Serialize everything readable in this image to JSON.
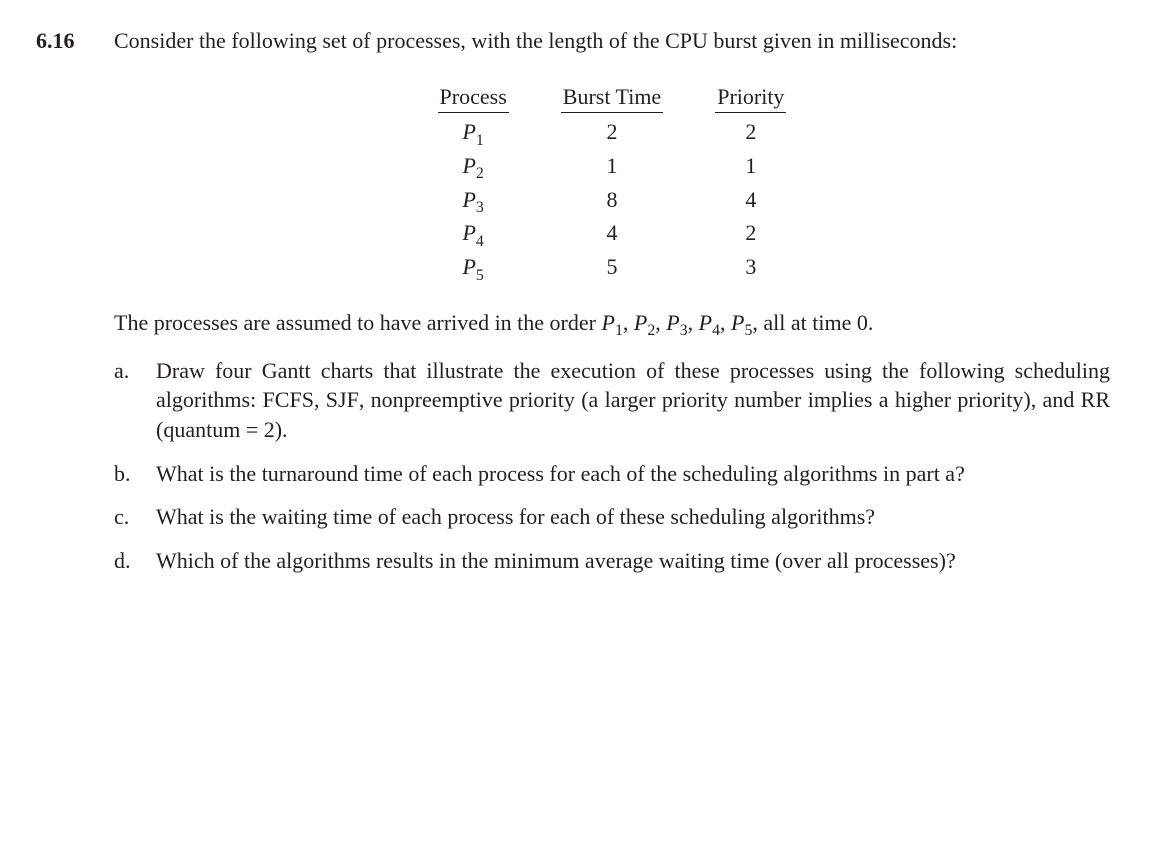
{
  "problem_number": "6.16",
  "intro": "Consider the following set of processes, with the length of the CPU burst given in milliseconds:",
  "table": {
    "headers": [
      "Process",
      "Burst Time",
      "Priority"
    ],
    "rows": [
      {
        "process": "P",
        "sub": "1",
        "burst": "2",
        "priority": "2"
      },
      {
        "process": "P",
        "sub": "2",
        "burst": "1",
        "priority": "1"
      },
      {
        "process": "P",
        "sub": "3",
        "burst": "8",
        "priority": "4"
      },
      {
        "process": "P",
        "sub": "4",
        "burst": "4",
        "priority": "2"
      },
      {
        "process": "P",
        "sub": "5",
        "burst": "5",
        "priority": "3"
      }
    ]
  },
  "after_table_pre": "The processes are assumed to have arrived in the order ",
  "after_table_post": ", all at time 0.",
  "order_list": [
    {
      "p": "P",
      "sub": "1"
    },
    {
      "p": "P",
      "sub": "2"
    },
    {
      "p": "P",
      "sub": "3"
    },
    {
      "p": "P",
      "sub": "4"
    },
    {
      "p": "P",
      "sub": "5"
    }
  ],
  "parts": {
    "a": {
      "label": "a.",
      "pre": "Draw four Gantt charts that illustrate the execution of these processes using the following scheduling algorithms: ",
      "sc1": "FCFS",
      "mid1": ", ",
      "sc2": "SJF",
      "mid2": ", nonpreemptive priority (a larger priority number implies a higher priority), and ",
      "sc3": "RR",
      "post": " (quantum = 2)."
    },
    "b": {
      "label": "b.",
      "text": "What is the turnaround time of each process for each of the scheduling algorithms in part a?"
    },
    "c": {
      "label": "c.",
      "text": "What is the waiting time of each process for each of these scheduling algorithms?"
    },
    "d": {
      "label": "d.",
      "text": "Which of the algorithms results in the minimum average waiting time (over all processes)?"
    }
  }
}
